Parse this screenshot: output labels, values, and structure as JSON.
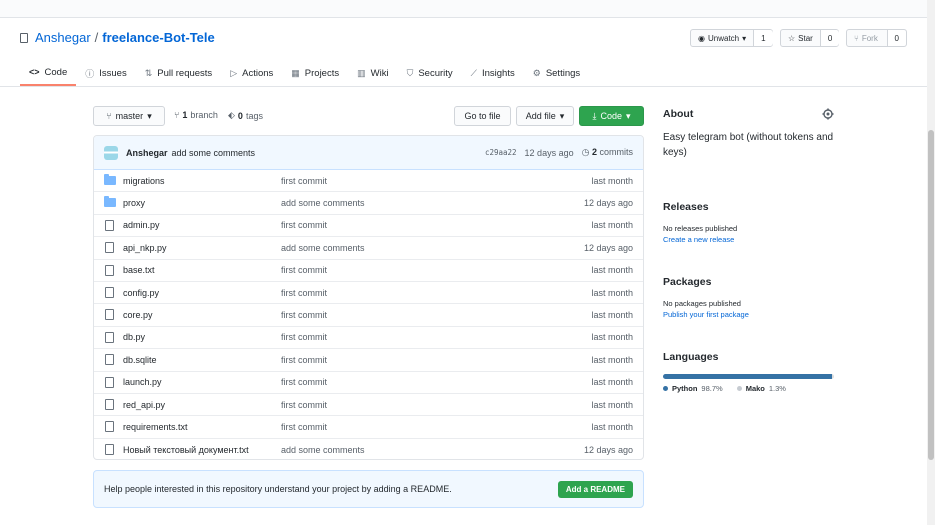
{
  "repo": {
    "owner": "Anshegar",
    "separator": "/",
    "name": "freelance-Bot-Tele"
  },
  "actions": {
    "watch": {
      "label": "Unwatch",
      "count": "1"
    },
    "star": {
      "label": "Star",
      "count": "0"
    },
    "fork": {
      "label": "Fork",
      "count": "0"
    }
  },
  "tabs": [
    {
      "label": "Code",
      "icon": "code-icon"
    },
    {
      "label": "Issues",
      "icon": "issue-icon"
    },
    {
      "label": "Pull requests",
      "icon": "pull-request-icon"
    },
    {
      "label": "Actions",
      "icon": "play-icon"
    },
    {
      "label": "Projects",
      "icon": "project-icon"
    },
    {
      "label": "Wiki",
      "icon": "book-icon"
    },
    {
      "label": "Security",
      "icon": "shield-icon"
    },
    {
      "label": "Insights",
      "icon": "graph-icon"
    },
    {
      "label": "Settings",
      "icon": "gear-icon"
    }
  ],
  "toolbar": {
    "branch": "master",
    "branches_count": "1",
    "branches_label": "branch",
    "tags_count": "0",
    "tags_label": "tags",
    "goto_file": "Go to file",
    "add_file": "Add file",
    "code": "Code"
  },
  "commit": {
    "author": "Anshegar",
    "message": "add some comments",
    "sha": "c29aa22",
    "age": "12 days ago",
    "commits_count": "2",
    "commits_label": "commits"
  },
  "files": [
    {
      "name": "migrations",
      "type": "folder",
      "message": "first commit",
      "age": "last month"
    },
    {
      "name": "proxy",
      "type": "folder",
      "message": "add some comments",
      "age": "12 days ago"
    },
    {
      "name": "admin.py",
      "type": "file",
      "message": "first commit",
      "age": "last month"
    },
    {
      "name": "api_nkp.py",
      "type": "file",
      "message": "add some comments",
      "age": "12 days ago"
    },
    {
      "name": "base.txt",
      "type": "file",
      "message": "first commit",
      "age": "last month"
    },
    {
      "name": "config.py",
      "type": "file",
      "message": "first commit",
      "age": "last month"
    },
    {
      "name": "core.py",
      "type": "file",
      "message": "first commit",
      "age": "last month"
    },
    {
      "name": "db.py",
      "type": "file",
      "message": "first commit",
      "age": "last month"
    },
    {
      "name": "db.sqlite",
      "type": "file",
      "message": "first commit",
      "age": "last month"
    },
    {
      "name": "launch.py",
      "type": "file",
      "message": "first commit",
      "age": "last month"
    },
    {
      "name": "red_api.py",
      "type": "file",
      "message": "first commit",
      "age": "last month"
    },
    {
      "name": "requirements.txt",
      "type": "file",
      "message": "first commit",
      "age": "last month"
    },
    {
      "name": "Новый текстовый документ.txt",
      "type": "file",
      "message": "add some comments",
      "age": "12 days ago"
    }
  ],
  "readme": {
    "text": "Help people interested in this repository understand your project by adding a README.",
    "button": "Add a README"
  },
  "about": {
    "title": "About",
    "description": "Easy telegram bot (without tokens and keys)"
  },
  "releases": {
    "title": "Releases",
    "status": "No releases published",
    "link": "Create a new release"
  },
  "packages": {
    "title": "Packages",
    "status": "No packages published",
    "link": "Publish your first package"
  },
  "languages": {
    "title": "Languages",
    "items": [
      {
        "name": "Python",
        "percent": "98.7%",
        "fraction": 0.987,
        "color": "#3572A5"
      },
      {
        "name": "Mako",
        "percent": "1.3%",
        "fraction": 0.013,
        "color": "#dddddd"
      }
    ]
  },
  "colors": {
    "accent": "#0366d6",
    "green": "#2ea44f",
    "tab_underline": "#f9826c"
  }
}
